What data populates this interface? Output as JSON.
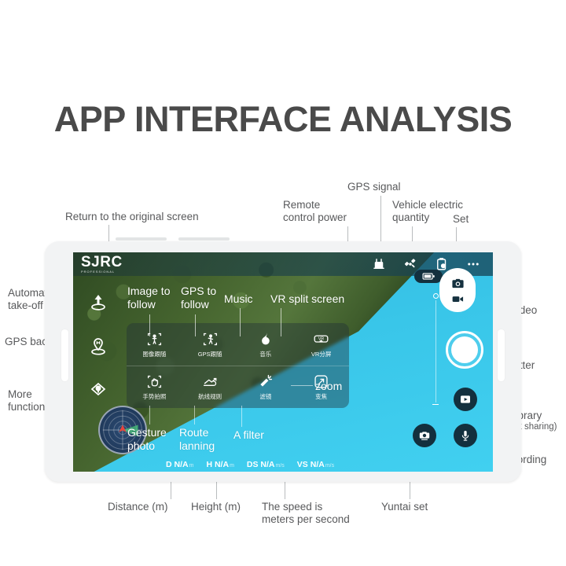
{
  "page": {
    "title": "APP INTERFACE ANALYSIS"
  },
  "app": {
    "logo": "SJRC",
    "logo_sub": "PROFESSIONAL",
    "topbar_icons": [
      {
        "name": "remote-control-icon",
        "label": "Remote control power"
      },
      {
        "name": "satellite-icon",
        "label": "GPS signal"
      },
      {
        "name": "battery-clock-icon",
        "label": "Vehicle electric quantity"
      },
      {
        "name": "more-dots-icon",
        "label": "Set"
      }
    ],
    "left_controls": [
      {
        "name": "takeoff-icon",
        "label": "Automatic take-off"
      },
      {
        "name": "gps-return-icon",
        "label": "GPS back"
      },
      {
        "name": "more-functions-icon",
        "label": "More functions"
      }
    ],
    "menu": {
      "row1": [
        {
          "icon": "image-follow-icon",
          "label": "图像跟随",
          "en": "Image to follow"
        },
        {
          "icon": "gps-follow-icon",
          "label": "GPS跟随",
          "en": "GPS to follow"
        },
        {
          "icon": "music-icon",
          "label": "音乐",
          "en": "Music"
        },
        {
          "icon": "vr-split-icon",
          "label": "VR分屏",
          "en": "VR split screen"
        }
      ],
      "row2": [
        {
          "icon": "gesture-photo-icon",
          "label": "手势拍照",
          "en": "Gesture photo"
        },
        {
          "icon": "route-plan-icon",
          "label": "航线规则",
          "en": "Route lanning"
        },
        {
          "icon": "filter-icon",
          "label": "滤镜",
          "en": "A filter"
        },
        {
          "icon": "zoom-icon",
          "label": "变焦",
          "en": "zoom"
        }
      ]
    },
    "telemetry": [
      {
        "key": "D",
        "value": "N/A",
        "unit": "m"
      },
      {
        "key": "H",
        "value": "N/A",
        "unit": "m"
      },
      {
        "key": "DS",
        "value": "N/A",
        "unit": "m/s"
      },
      {
        "key": "VS",
        "value": "N/A",
        "unit": "m/s"
      }
    ],
    "right_controls": [
      {
        "name": "photo-video-toggle",
        "label": "Photo/video toggle"
      },
      {
        "name": "shutter-button",
        "label": "The shutter"
      },
      {
        "name": "media-library-button",
        "label": "Media library"
      },
      {
        "name": "record-button",
        "label": "The recording"
      },
      {
        "name": "gimbal-button",
        "label": "Yuntai set"
      }
    ]
  },
  "callouts": {
    "return_original": "Return to the original screen",
    "remote_power": "Remote\ncontrol power",
    "gps_signal": "GPS signal",
    "vehicle_electric": "Vehicle electric\nquantity",
    "set": "Set",
    "automatic_takeoff": "Automatic\ntake-off",
    "gps_back": "GPS back",
    "more_functions": "More\nfunctions",
    "image_follow": "Image to\nfollow",
    "gps_follow": "GPS to\nfollow",
    "music": "Music",
    "vr_split": "VR split screen",
    "gesture_photo": "Gesture\nphoto",
    "route_planning": "Route\nlanning",
    "a_filter": "A filter",
    "zoom": "zoom",
    "photo_video_toggle": "Photo/video\ntoggle",
    "the_shutter": "The shutter",
    "media_library": "Media library",
    "media_library_sub": "(One-click sharing)",
    "the_recording": "The recording",
    "distance": "Distance (m)",
    "height": "Height (m)",
    "speed": "The speed is\nmeters per second",
    "yuntai_set": "Yuntai set"
  },
  "colors": {
    "title": "#4a4a4a",
    "callout": "#58595b",
    "leader": "#b9bcbe",
    "water": "#3ccbee",
    "forest": "#46652f",
    "app_dark": "#13303e"
  }
}
